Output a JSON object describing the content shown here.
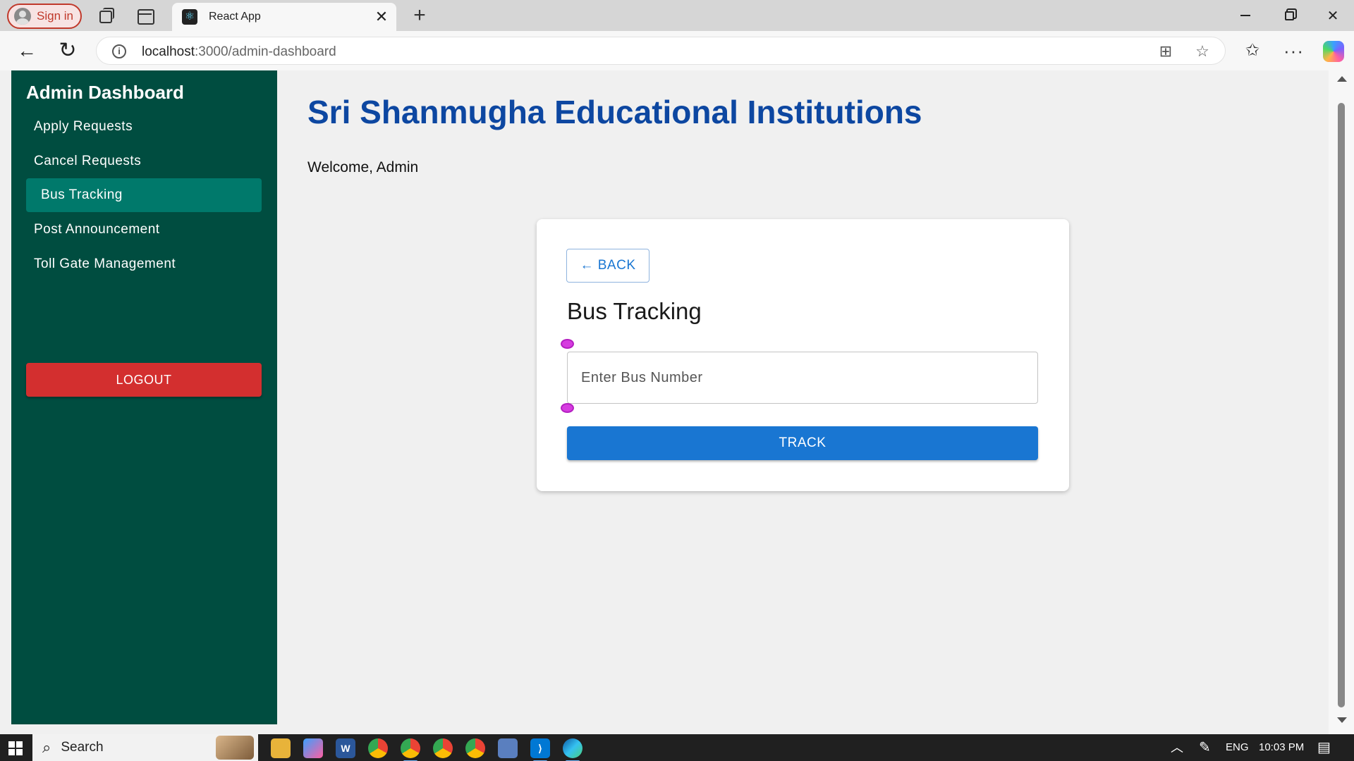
{
  "browser": {
    "profile_label": "Sign in",
    "tab_title": "React App",
    "tab_close": "✕",
    "new_tab": "+",
    "url_host": "localhost",
    "url_path": ":3000/admin-dashboard",
    "icons": [
      "back-arrow-icon",
      "reload-icon",
      "info-icon",
      "app-available-icon",
      "favorite-star-icon",
      "favorites-icon",
      "more-icon",
      "copilot-icon"
    ]
  },
  "sidebar": {
    "title": "Admin Dashboard",
    "items": [
      {
        "label": "Apply Requests",
        "active": false
      },
      {
        "label": "Cancel Requests",
        "active": false
      },
      {
        "label": "Bus Tracking",
        "active": true
      },
      {
        "label": "Post Announcement",
        "active": false
      },
      {
        "label": "Toll Gate Management",
        "active": false
      }
    ],
    "logout_label": "LOGOUT"
  },
  "main": {
    "title": "Sri Shanmugha Educational Institutions",
    "welcome": "Welcome, Admin"
  },
  "card": {
    "back_label": "← BACK",
    "title": "Bus Tracking",
    "input_placeholder": "Enter Bus Number",
    "input_value": "",
    "track_label": "TRACK"
  },
  "taskbar": {
    "search_label": "Search",
    "language": "ENG",
    "time": "10:03 PM"
  },
  "colors": {
    "sidebar_bg": "#004d40",
    "sidebar_active": "#00796b",
    "logout_bg": "#d32f2f",
    "title_blue": "#0d47a1",
    "primary": "#1976d2",
    "page_bg": "#f0f0f0"
  }
}
